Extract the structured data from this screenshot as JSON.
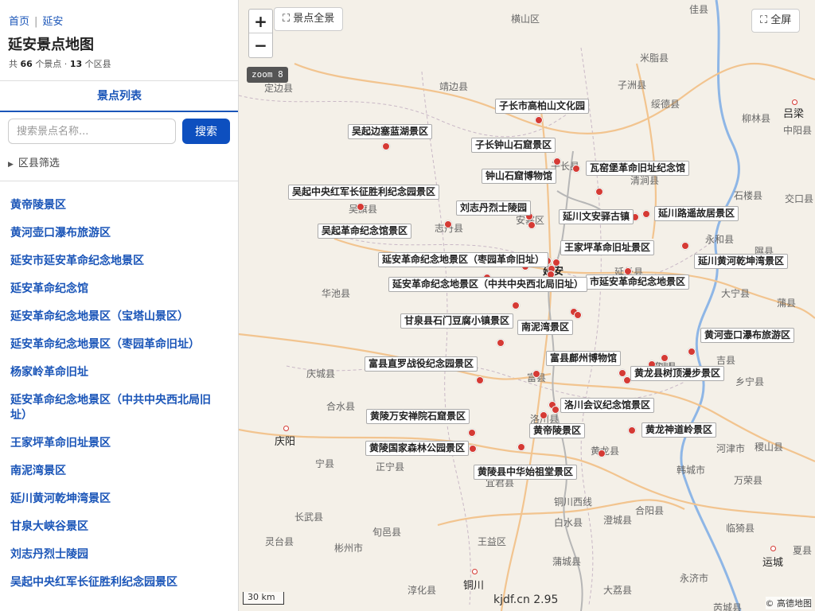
{
  "breadcrumb": {
    "home": "首页",
    "current": "延安"
  },
  "page_title": "延安景点地图",
  "stats": {
    "prefix": "共",
    "spot_count": "66",
    "spot_unit": "个景点 ·",
    "county_count": "13",
    "county_unit": "个区县"
  },
  "tab_label": "景点列表",
  "search": {
    "placeholder": "搜索景点名称...",
    "button": "搜索"
  },
  "filter_label": "区县筛选",
  "list": [
    "黄帝陵景区",
    "黄河壶口瀑布旅游区",
    "延安市延安革命纪念地景区",
    "延安革命纪念馆",
    "延安革命纪念地景区（宝塔山景区）",
    "延安革命纪念地景区（枣园革命旧址）",
    "杨家岭革命旧址",
    "延安革命纪念地景区（中共中央西北局旧址）",
    "王家坪革命旧址景区",
    "南泥湾景区",
    "延川黄河乾坤湾景区",
    "甘泉大峡谷景区",
    "刘志丹烈士陵园",
    "吴起中央红军长征胜利纪念园景区"
  ],
  "map": {
    "zoom_in": "+",
    "zoom_out": "−",
    "overview_button": "⛶ 景点全景",
    "fullscreen_button": "⛶ 全屏",
    "zoom_badge": "zoom 8",
    "scale": "30 km",
    "watermark": "kjdf.cn 2.95",
    "credit": "© 高德地图",
    "labels": [
      "子长市高柏山文化园",
      "吴起边塞蓝湖景区",
      "子长钟山石窟景区",
      "瓦窑堡革命旧址纪念馆",
      "钟山石窟博物馆",
      "吴起中央红军长征胜利纪念园景区",
      "刘志丹烈士陵园",
      "延川文安驿古镇",
      "延川路遥故居景区",
      "吴起革命纪念馆景区",
      "王家坪革命旧址景区",
      "延川黄河乾坤湾景区",
      "延安革命纪念地景区（枣园革命旧址）",
      "市延安革命纪念地景区",
      "延安革命纪念地景区（中共中央西北局旧址）",
      "甘泉县石门豆腐小镇景区",
      "南泥湾景区",
      "黄河壶口瀑布旅游区",
      "富县鄜州博物馆",
      "富县直罗战役纪念园景区",
      "黄龙县树顶漫步景区",
      "洛川会议纪念馆景区",
      "黄陵万安禅院石窟景区",
      "黄帝陵景区",
      "黄龙神道岭景区",
      "黄陵国家森林公园景区",
      "黄陵县中华始祖堂景区"
    ],
    "towns": [
      "横山区",
      "佳县",
      "米脂县",
      "靖边县",
      "子洲县",
      "绥德县",
      "吕梁",
      "柳林县",
      "中阳县",
      "定边县",
      "清涧县",
      "石楼县",
      "交口县",
      "吴旗县",
      "安塞区",
      "志丹县",
      "永和县",
      "隰县",
      "延长县",
      "华池县",
      "大宁县",
      "蒲县",
      "吉县",
      "庆城县",
      "宜川县",
      "乡宁县",
      "合水县",
      "富县",
      "洛川县",
      "黄龙县",
      "河津市",
      "稷山县",
      "庆阳",
      "宁县",
      "正宁县",
      "宜君县",
      "韩城市",
      "万荣县",
      "旬邑县",
      "铜川西线",
      "白水县",
      "澄城县",
      "合阳县",
      "临猗县",
      "长武县",
      "灵台县",
      "彬州市",
      "王益区",
      "蒲城县",
      "运城",
      "铜川",
      "淳化县",
      "大荔县",
      "永济市",
      "芮城县",
      "夏县",
      "子长县",
      "延安",
      "宜川"
    ]
  }
}
